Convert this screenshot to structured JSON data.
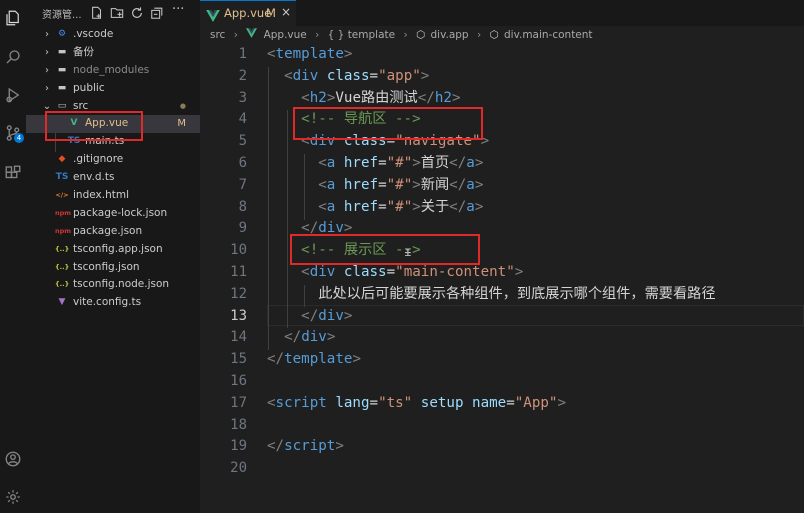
{
  "activity_bar": {
    "items": [
      {
        "name": "explorer-icon"
      },
      {
        "name": "search-icon"
      },
      {
        "name": "run-debug-icon"
      },
      {
        "name": "source-control-icon",
        "badge": "4"
      },
      {
        "name": "extensions-icon"
      },
      {
        "name": "account-icon"
      },
      {
        "name": "manage-gear-icon"
      }
    ]
  },
  "explorer": {
    "title": "资源管...",
    "tree": [
      {
        "label": ".vscode",
        "type": "folder",
        "icon_text": "⚙",
        "icon_color": "#3b8eea",
        "indent": 0,
        "chevron": "›"
      },
      {
        "label": "备份",
        "type": "folder",
        "icon_text": "▬",
        "icon_color": "#c5c5c5",
        "indent": 0,
        "chevron": "›"
      },
      {
        "label": "node_modules",
        "type": "folder",
        "icon_text": "▬",
        "icon_color": "#c5c5c5",
        "indent": 0,
        "chevron": "›",
        "dimmed": true
      },
      {
        "label": "public",
        "type": "folder",
        "icon_text": "▬",
        "icon_color": "#c5c5c5",
        "indent": 0,
        "chevron": "›"
      },
      {
        "label": "src",
        "type": "folder",
        "icon_text": "▭",
        "icon_color": "#c5c5c5",
        "indent": 0,
        "chevron": "⌄",
        "status": "●"
      },
      {
        "label": "App.vue",
        "type": "file",
        "icon_text": "V",
        "icon_color": "#41b883",
        "indent": 1,
        "status": "M",
        "modified": true,
        "active": true
      },
      {
        "label": "main.ts",
        "type": "file",
        "icon_text": "TS",
        "icon_color": "#3178c6",
        "indent": 1
      },
      {
        "label": ".gitignore",
        "type": "file",
        "icon_text": "◆",
        "icon_color": "#e44d26",
        "indent": 0
      },
      {
        "label": "env.d.ts",
        "type": "file",
        "icon_text": "TS",
        "icon_color": "#3178c6",
        "indent": 0
      },
      {
        "label": "index.html",
        "type": "file",
        "icon_text": "</>",
        "icon_color": "#e37933",
        "indent": 0
      },
      {
        "label": "package-lock.json",
        "type": "file",
        "icon_text": "npm",
        "icon_color": "#cb3837",
        "indent": 0
      },
      {
        "label": "package.json",
        "type": "file",
        "icon_text": "npm",
        "icon_color": "#cb3837",
        "indent": 0
      },
      {
        "label": "tsconfig.app.json",
        "type": "file",
        "icon_text": "{..}",
        "icon_color": "#cbcb41",
        "indent": 0
      },
      {
        "label": "tsconfig.json",
        "type": "file",
        "icon_text": "{..}",
        "icon_color": "#cbcb41",
        "indent": 0
      },
      {
        "label": "tsconfig.node.json",
        "type": "file",
        "icon_text": "{..}",
        "icon_color": "#cbcb41",
        "indent": 0
      },
      {
        "label": "vite.config.ts",
        "type": "file",
        "icon_text": "▼",
        "icon_color": "#a074c4",
        "indent": 0
      }
    ]
  },
  "tab": {
    "name": "App.vue",
    "modified": "M",
    "close": "×"
  },
  "breadcrumbs": [
    "src",
    "App.vue",
    "{ } template",
    "div.app",
    "div.main-content"
  ],
  "code": {
    "current_line": 13,
    "lines": [
      {
        "n": "1",
        "t": [
          [
            "br",
            "<"
          ],
          [
            "tag",
            "template"
          ],
          [
            "br",
            ">"
          ]
        ]
      },
      {
        "n": "2",
        "t": [
          [
            "sp",
            "  "
          ],
          [
            "br",
            "<"
          ],
          [
            "tag",
            "div "
          ],
          [
            "attr",
            "class"
          ],
          [
            "txt",
            "="
          ],
          [
            "str",
            "\"app\""
          ],
          [
            "br",
            ">"
          ]
        ]
      },
      {
        "n": "3",
        "t": [
          [
            "sp",
            "    "
          ],
          [
            "br",
            "<"
          ],
          [
            "tag",
            "h2"
          ],
          [
            "br",
            ">"
          ],
          [
            "txt",
            "Vue路由测试"
          ],
          [
            "br",
            "</"
          ],
          [
            "tag",
            "h2"
          ],
          [
            "br",
            ">"
          ]
        ]
      },
      {
        "n": "4",
        "t": [
          [
            "sp",
            "    "
          ],
          [
            "cm",
            "<!-- 导航区 -->"
          ]
        ]
      },
      {
        "n": "5",
        "t": [
          [
            "sp",
            "    "
          ],
          [
            "br",
            "<"
          ],
          [
            "tag",
            "div "
          ],
          [
            "attr",
            "class"
          ],
          [
            "txt",
            "="
          ],
          [
            "str",
            "\"navigate\""
          ],
          [
            "br",
            ">"
          ]
        ]
      },
      {
        "n": "6",
        "t": [
          [
            "sp",
            "      "
          ],
          [
            "br",
            "<"
          ],
          [
            "tag",
            "a "
          ],
          [
            "attr",
            "href"
          ],
          [
            "txt",
            "="
          ],
          [
            "str",
            "\"#\""
          ],
          [
            "br",
            ">"
          ],
          [
            "txt",
            "首页"
          ],
          [
            "br",
            "</"
          ],
          [
            "tag",
            "a"
          ],
          [
            "br",
            ">"
          ]
        ]
      },
      {
        "n": "7",
        "t": [
          [
            "sp",
            "      "
          ],
          [
            "br",
            "<"
          ],
          [
            "tag",
            "a "
          ],
          [
            "attr",
            "href"
          ],
          [
            "txt",
            "="
          ],
          [
            "str",
            "\"#\""
          ],
          [
            "br",
            ">"
          ],
          [
            "txt",
            "新闻"
          ],
          [
            "br",
            "</"
          ],
          [
            "tag",
            "a"
          ],
          [
            "br",
            ">"
          ]
        ]
      },
      {
        "n": "8",
        "t": [
          [
            "sp",
            "      "
          ],
          [
            "br",
            "<"
          ],
          [
            "tag",
            "a "
          ],
          [
            "attr",
            "href"
          ],
          [
            "txt",
            "="
          ],
          [
            "str",
            "\"#\""
          ],
          [
            "br",
            ">"
          ],
          [
            "txt",
            "关于"
          ],
          [
            "br",
            "</"
          ],
          [
            "tag",
            "a"
          ],
          [
            "br",
            ">"
          ]
        ]
      },
      {
        "n": "9",
        "t": [
          [
            "sp",
            "    "
          ],
          [
            "br",
            "</"
          ],
          [
            "tag",
            "div"
          ],
          [
            "br",
            ">"
          ]
        ]
      },
      {
        "n": "10",
        "t": [
          [
            "sp",
            "    "
          ],
          [
            "cm",
            "<!-- 展示区 -->"
          ]
        ]
      },
      {
        "n": "11",
        "t": [
          [
            "sp",
            "    "
          ],
          [
            "br",
            "<"
          ],
          [
            "tag",
            "div "
          ],
          [
            "attr",
            "class"
          ],
          [
            "txt",
            "="
          ],
          [
            "str",
            "\"main-content\""
          ],
          [
            "br",
            ">"
          ]
        ]
      },
      {
        "n": "12",
        "t": [
          [
            "sp",
            "      "
          ],
          [
            "txt",
            "此处以后可能要展示各种组件，到底展示哪个组件，需要看路径"
          ]
        ]
      },
      {
        "n": "13",
        "t": [
          [
            "sp",
            "    "
          ],
          [
            "br",
            "</"
          ],
          [
            "tag",
            "div"
          ],
          [
            "br",
            ">"
          ]
        ]
      },
      {
        "n": "14",
        "t": [
          [
            "sp",
            "  "
          ],
          [
            "br",
            "</"
          ],
          [
            "tag",
            "div"
          ],
          [
            "br",
            ">"
          ]
        ]
      },
      {
        "n": "15",
        "t": [
          [
            "br",
            "</"
          ],
          [
            "tag",
            "template"
          ],
          [
            "br",
            ">"
          ]
        ]
      },
      {
        "n": "16",
        "t": []
      },
      {
        "n": "17",
        "t": [
          [
            "br",
            "<"
          ],
          [
            "tag",
            "script "
          ],
          [
            "attr",
            "lang"
          ],
          [
            "txt",
            "="
          ],
          [
            "str",
            "\"ts\" "
          ],
          [
            "attr",
            "setup "
          ],
          [
            "attr",
            "name"
          ],
          [
            "txt",
            "="
          ],
          [
            "str",
            "\"App\""
          ],
          [
            "br",
            ">"
          ]
        ]
      },
      {
        "n": "18",
        "t": []
      },
      {
        "n": "19",
        "t": [
          [
            "br",
            "</"
          ],
          [
            "tag",
            "script"
          ],
          [
            "br",
            ">"
          ]
        ]
      },
      {
        "n": "20",
        "t": []
      }
    ]
  },
  "colors": {
    "annotation_box": "#e02a2a",
    "modified": "#e2c08d",
    "vue_green": "#41b883"
  }
}
